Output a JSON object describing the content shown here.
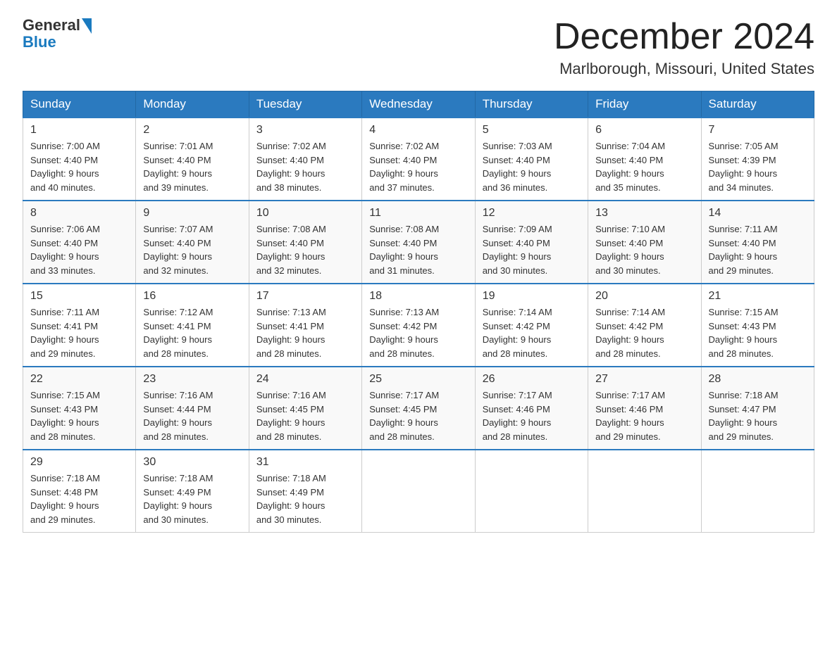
{
  "logo": {
    "general": "General",
    "blue": "Blue"
  },
  "title": "December 2024",
  "location": "Marlborough, Missouri, United States",
  "days_of_week": [
    "Sunday",
    "Monday",
    "Tuesday",
    "Wednesday",
    "Thursday",
    "Friday",
    "Saturday"
  ],
  "weeks": [
    [
      {
        "day": "1",
        "sunrise": "7:00 AM",
        "sunset": "4:40 PM",
        "daylight": "9 hours and 40 minutes."
      },
      {
        "day": "2",
        "sunrise": "7:01 AM",
        "sunset": "4:40 PM",
        "daylight": "9 hours and 39 minutes."
      },
      {
        "day": "3",
        "sunrise": "7:02 AM",
        "sunset": "4:40 PM",
        "daylight": "9 hours and 38 minutes."
      },
      {
        "day": "4",
        "sunrise": "7:02 AM",
        "sunset": "4:40 PM",
        "daylight": "9 hours and 37 minutes."
      },
      {
        "day": "5",
        "sunrise": "7:03 AM",
        "sunset": "4:40 PM",
        "daylight": "9 hours and 36 minutes."
      },
      {
        "day": "6",
        "sunrise": "7:04 AM",
        "sunset": "4:40 PM",
        "daylight": "9 hours and 35 minutes."
      },
      {
        "day": "7",
        "sunrise": "7:05 AM",
        "sunset": "4:39 PM",
        "daylight": "9 hours and 34 minutes."
      }
    ],
    [
      {
        "day": "8",
        "sunrise": "7:06 AM",
        "sunset": "4:40 PM",
        "daylight": "9 hours and 33 minutes."
      },
      {
        "day": "9",
        "sunrise": "7:07 AM",
        "sunset": "4:40 PM",
        "daylight": "9 hours and 32 minutes."
      },
      {
        "day": "10",
        "sunrise": "7:08 AM",
        "sunset": "4:40 PM",
        "daylight": "9 hours and 32 minutes."
      },
      {
        "day": "11",
        "sunrise": "7:08 AM",
        "sunset": "4:40 PM",
        "daylight": "9 hours and 31 minutes."
      },
      {
        "day": "12",
        "sunrise": "7:09 AM",
        "sunset": "4:40 PM",
        "daylight": "9 hours and 30 minutes."
      },
      {
        "day": "13",
        "sunrise": "7:10 AM",
        "sunset": "4:40 PM",
        "daylight": "9 hours and 30 minutes."
      },
      {
        "day": "14",
        "sunrise": "7:11 AM",
        "sunset": "4:40 PM",
        "daylight": "9 hours and 29 minutes."
      }
    ],
    [
      {
        "day": "15",
        "sunrise": "7:11 AM",
        "sunset": "4:41 PM",
        "daylight": "9 hours and 29 minutes."
      },
      {
        "day": "16",
        "sunrise": "7:12 AM",
        "sunset": "4:41 PM",
        "daylight": "9 hours and 28 minutes."
      },
      {
        "day": "17",
        "sunrise": "7:13 AM",
        "sunset": "4:41 PM",
        "daylight": "9 hours and 28 minutes."
      },
      {
        "day": "18",
        "sunrise": "7:13 AM",
        "sunset": "4:42 PM",
        "daylight": "9 hours and 28 minutes."
      },
      {
        "day": "19",
        "sunrise": "7:14 AM",
        "sunset": "4:42 PM",
        "daylight": "9 hours and 28 minutes."
      },
      {
        "day": "20",
        "sunrise": "7:14 AM",
        "sunset": "4:42 PM",
        "daylight": "9 hours and 28 minutes."
      },
      {
        "day": "21",
        "sunrise": "7:15 AM",
        "sunset": "4:43 PM",
        "daylight": "9 hours and 28 minutes."
      }
    ],
    [
      {
        "day": "22",
        "sunrise": "7:15 AM",
        "sunset": "4:43 PM",
        "daylight": "9 hours and 28 minutes."
      },
      {
        "day": "23",
        "sunrise": "7:16 AM",
        "sunset": "4:44 PM",
        "daylight": "9 hours and 28 minutes."
      },
      {
        "day": "24",
        "sunrise": "7:16 AM",
        "sunset": "4:45 PM",
        "daylight": "9 hours and 28 minutes."
      },
      {
        "day": "25",
        "sunrise": "7:17 AM",
        "sunset": "4:45 PM",
        "daylight": "9 hours and 28 minutes."
      },
      {
        "day": "26",
        "sunrise": "7:17 AM",
        "sunset": "4:46 PM",
        "daylight": "9 hours and 28 minutes."
      },
      {
        "day": "27",
        "sunrise": "7:17 AM",
        "sunset": "4:46 PM",
        "daylight": "9 hours and 29 minutes."
      },
      {
        "day": "28",
        "sunrise": "7:18 AM",
        "sunset": "4:47 PM",
        "daylight": "9 hours and 29 minutes."
      }
    ],
    [
      {
        "day": "29",
        "sunrise": "7:18 AM",
        "sunset": "4:48 PM",
        "daylight": "9 hours and 29 minutes."
      },
      {
        "day": "30",
        "sunrise": "7:18 AM",
        "sunset": "4:49 PM",
        "daylight": "9 hours and 30 minutes."
      },
      {
        "day": "31",
        "sunrise": "7:18 AM",
        "sunset": "4:49 PM",
        "daylight": "9 hours and 30 minutes."
      },
      null,
      null,
      null,
      null
    ]
  ],
  "labels": {
    "sunrise": "Sunrise:",
    "sunset": "Sunset:",
    "daylight": "Daylight:"
  }
}
